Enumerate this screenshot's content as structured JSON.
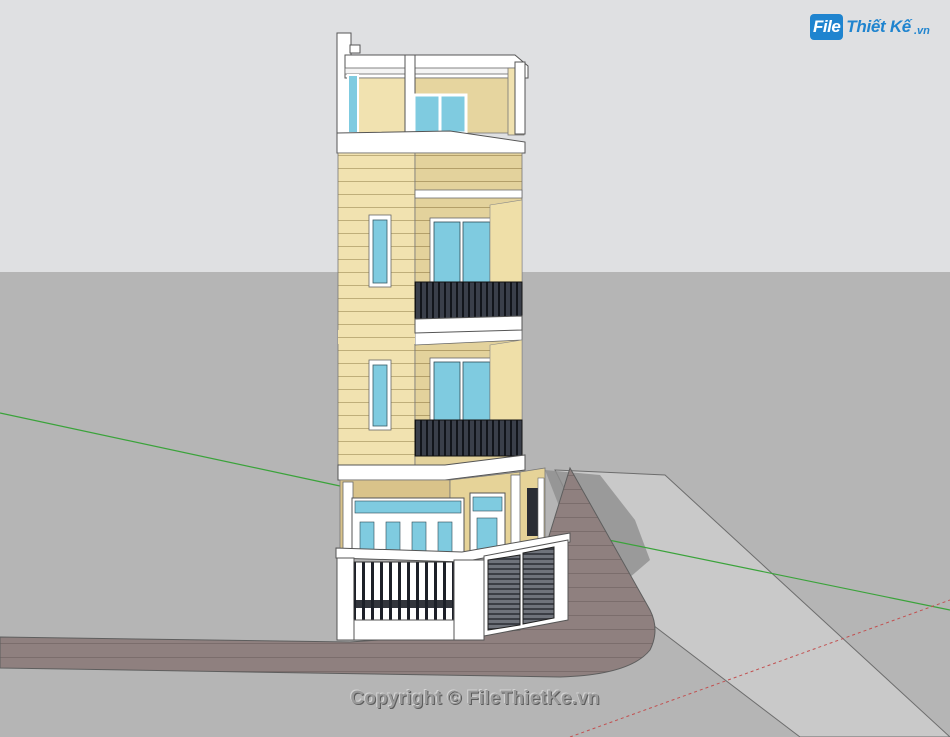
{
  "watermark": {
    "logo_part1": "File",
    "logo_part2": "Thiết Kế",
    "logo_part3": ".vn",
    "copyright": "Copyright © FileThietKe.vn"
  },
  "colors": {
    "sky": "#dfe0e2",
    "ground": "#b5b5b5",
    "sidewalk": "#8e7f7e",
    "wall": "#f1e2b0",
    "wall_shade": "#d9c98f",
    "trim": "#ffffff",
    "glass": "#7fcbe0",
    "railing": "#1d2028",
    "axis_green": "#3aa33a",
    "axis_red": "#c25050",
    "logo_blue": "#1f84cf"
  }
}
